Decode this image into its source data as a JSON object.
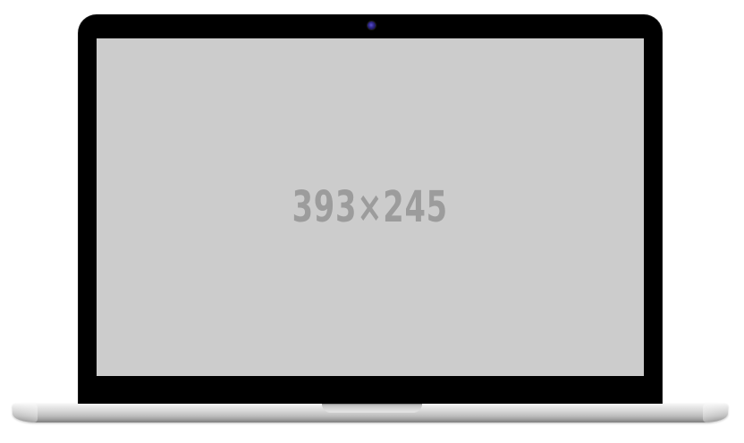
{
  "screen": {
    "placeholder_label": "393×245",
    "background_color": "#cccccc",
    "text_color": "#9c9c9c"
  },
  "device": {
    "bezel_color": "#000000",
    "camera_color": "#3a2fa8",
    "body_color": "#d4d4d4"
  },
  "icons": {
    "camera": "camera-icon"
  }
}
